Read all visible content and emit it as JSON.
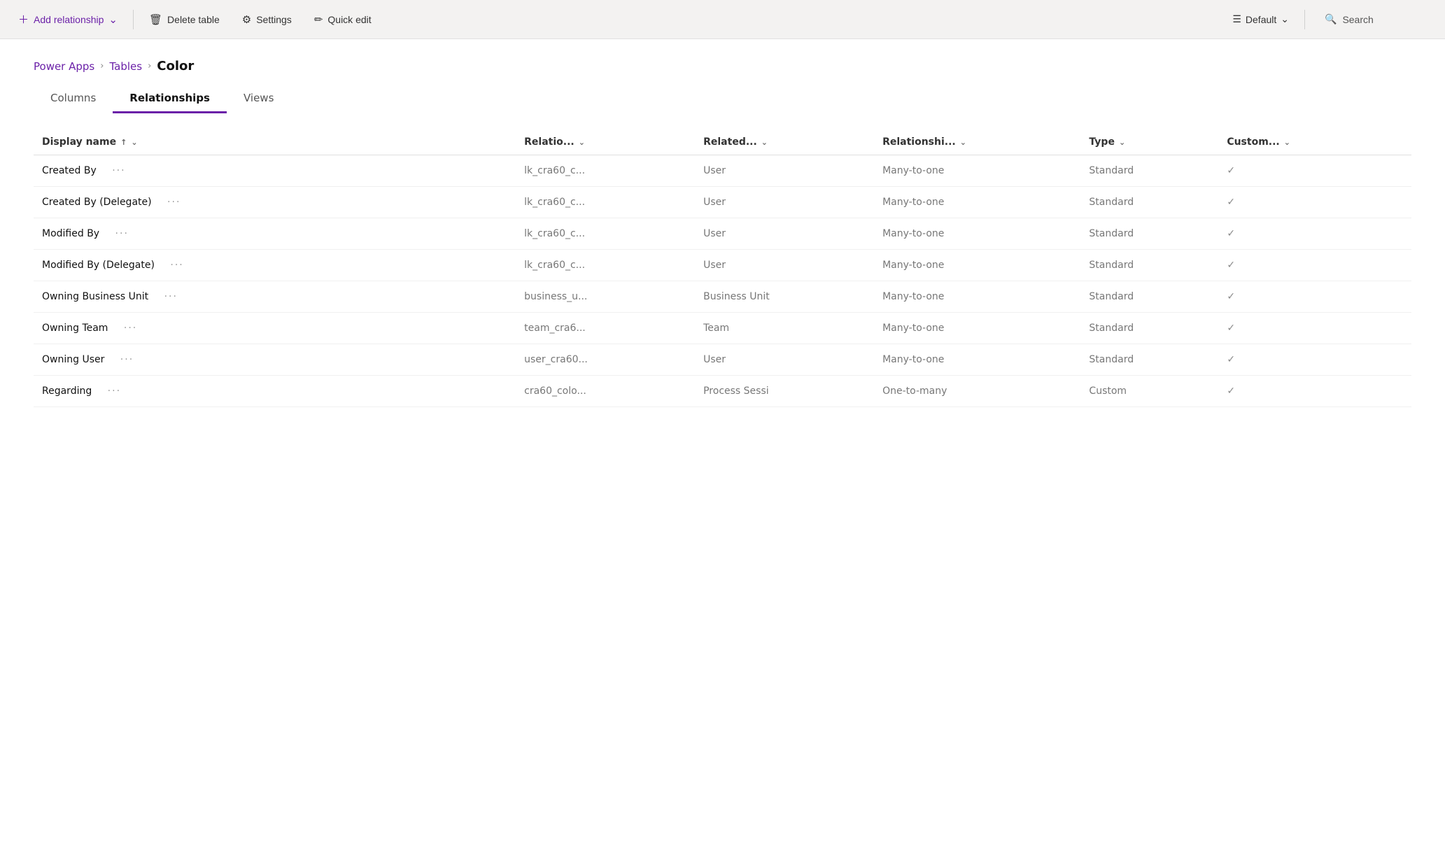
{
  "toolbar": {
    "add_label": "Add relationship",
    "delete_label": "Delete table",
    "settings_label": "Settings",
    "quick_edit_label": "Quick edit",
    "default_label": "Default",
    "search_label": "Search"
  },
  "breadcrumb": {
    "app_label": "Power Apps",
    "tables_label": "Tables",
    "current_label": "Color"
  },
  "tabs": [
    {
      "id": "columns",
      "label": "Columns"
    },
    {
      "id": "relationships",
      "label": "Relationships"
    },
    {
      "id": "views",
      "label": "Views"
    }
  ],
  "active_tab": "relationships",
  "table": {
    "columns": [
      {
        "id": "display_name",
        "label": "Display name",
        "sortable": true,
        "has_sort_asc": true,
        "has_dropdown": true
      },
      {
        "id": "relation",
        "label": "Relatio...",
        "sortable": false,
        "has_dropdown": true
      },
      {
        "id": "related",
        "label": "Related...",
        "sortable": false,
        "has_dropdown": true
      },
      {
        "id": "relationship",
        "label": "Relationshi...",
        "sortable": false,
        "has_dropdown": true
      },
      {
        "id": "type",
        "label": "Type",
        "sortable": false,
        "has_dropdown": true
      },
      {
        "id": "custom",
        "label": "Custom...",
        "sortable": false,
        "has_dropdown": true
      }
    ],
    "rows": [
      {
        "display_name": "Created By",
        "relation": "lk_cra60_c...",
        "related": "User",
        "relationship": "Many-to-one",
        "type": "Standard",
        "custom": "✓"
      },
      {
        "display_name": "Created By (Delegate)",
        "relation": "lk_cra60_c...",
        "related": "User",
        "relationship": "Many-to-one",
        "type": "Standard",
        "custom": "✓"
      },
      {
        "display_name": "Modified By",
        "relation": "lk_cra60_c...",
        "related": "User",
        "relationship": "Many-to-one",
        "type": "Standard",
        "custom": "✓"
      },
      {
        "display_name": "Modified By (Delegate)",
        "relation": "lk_cra60_c...",
        "related": "User",
        "relationship": "Many-to-one",
        "type": "Standard",
        "custom": "✓"
      },
      {
        "display_name": "Owning Business Unit",
        "relation": "business_u...",
        "related": "Business Unit",
        "relationship": "Many-to-one",
        "type": "Standard",
        "custom": "✓"
      },
      {
        "display_name": "Owning Team",
        "relation": "team_cra6...",
        "related": "Team",
        "relationship": "Many-to-one",
        "type": "Standard",
        "custom": "✓"
      },
      {
        "display_name": "Owning User",
        "relation": "user_cra60...",
        "related": "User",
        "relationship": "Many-to-one",
        "type": "Standard",
        "custom": "✓"
      },
      {
        "display_name": "Regarding",
        "relation": "cra60_colo...",
        "related": "Process Sessi",
        "relationship": "One-to-many",
        "type": "Custom",
        "custom": "✓"
      }
    ]
  }
}
